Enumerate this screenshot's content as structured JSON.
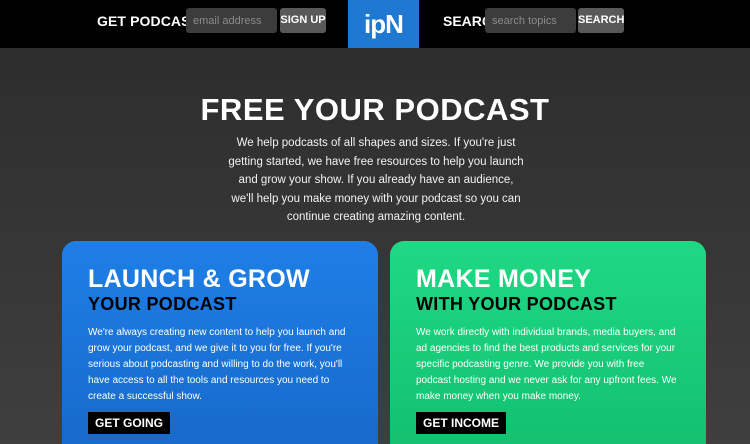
{
  "header": {
    "tips_label": "GET PODCAST TIPS",
    "email_placeholder": "email address",
    "signup_label": "SIGN UP",
    "logo_text": "ipN",
    "search_label": "SEARCH",
    "search_placeholder": "search topics",
    "search_button": "SEARCH",
    "logo_color": "#1f78d1"
  },
  "hero": {
    "title": "FREE YOUR PODCAST",
    "text": "We help podcasts of all shapes and sizes. If you're just getting started, we have free resources to help you launch and grow your show. If you already have an audience, we'll help you make money with your podcast so you can continue creating amazing content."
  },
  "cards": [
    {
      "title": "LAUNCH & GROW",
      "subtitle": "YOUR PODCAST",
      "text": "We're always creating new content to help you launch and grow your podcast, and we give it to you for free. If you're serious about podcasting and willing to do the work, you'll have access to all the tools and resources you need to create a successful show.",
      "button": "GET GOING",
      "color": "#1e7fe6"
    },
    {
      "title": "MAKE MONEY",
      "subtitle": "WITH YOUR PODCAST",
      "text": "We work directly with individual brands, media buyers, and ad agencies to find the best products and services for your specific podcasting genre. We provide you with free podcast hosting and we never ask for any upfront fees. We make money when you make money.",
      "button": "GET INCOME",
      "color": "#1fd984"
    }
  ]
}
